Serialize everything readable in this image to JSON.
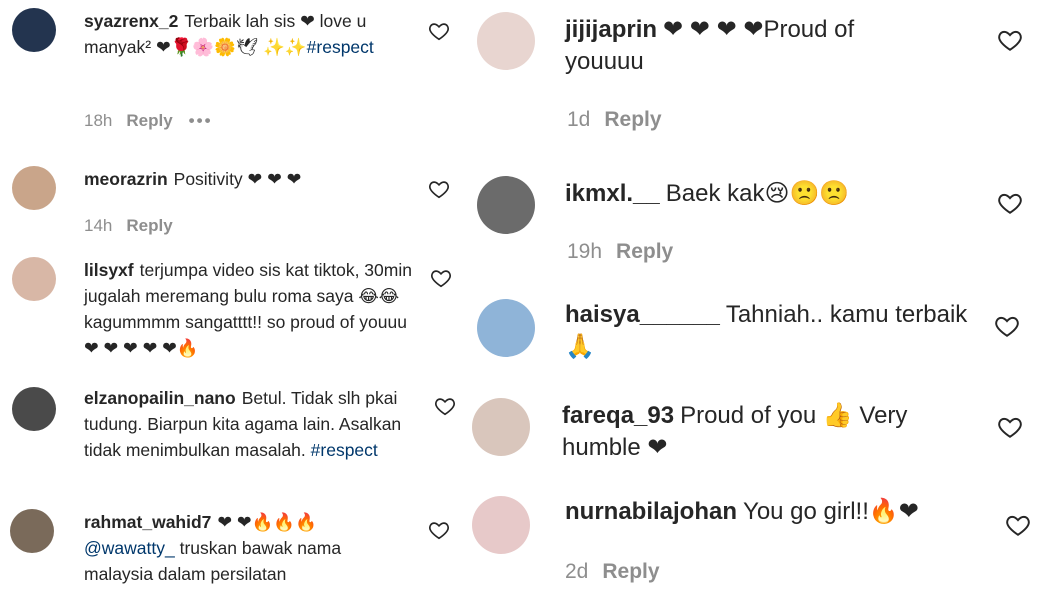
{
  "left": [
    {
      "username": "syazrenx_2",
      "text": "Terbaik lah sis ❤ love u manyak² ❤🌹🌸🌼🕊 ✨✨",
      "hashtag": "#respect",
      "time": "18h",
      "reply": "Reply",
      "more": "•••",
      "avatar_color": "#23344f"
    },
    {
      "username": "meorazrin",
      "text": "Positivity ❤ ❤ ❤",
      "time": "14h",
      "reply": "Reply",
      "avatar_color": "#c9a58a"
    },
    {
      "username": "lilsyxf",
      "text": "terjumpa video sis kat tiktok, 30min jugalah meremang bulu roma saya 😂😂 kagummmm sangatttt!! so proud of youuu❤ ❤ ❤ ❤ ❤🔥",
      "avatar_color": "#d8b7a6"
    },
    {
      "username": "elzanopailin_nano",
      "text": "Betul. Tidak slh pkai tudung. Biarpun kita agama lain. Asalkan tidak menimbulkan masalah.",
      "hashtag": "#respect",
      "avatar_color": "#4a4a4a"
    },
    {
      "username": "rahmat_wahid7",
      "text": "❤ ❤🔥🔥🔥",
      "mention": "@wawatty_",
      "text2": "truskan bawak nama malaysia dalam persilatan",
      "avatar_color": "#7a6a5a"
    }
  ],
  "right": [
    {
      "username": "jijijaprin",
      "text": "❤ ❤ ❤ ❤Proud of youuuu",
      "time": "1d",
      "reply": "Reply",
      "avatar_color": "#e8d5d0"
    },
    {
      "username": "ikmxl.__",
      "text": "Baek kak😢🙁🙁",
      "time": "19h",
      "reply": "Reply",
      "avatar_color": "#6b6b6b"
    },
    {
      "username": "haisya______",
      "text": "Tahniah.. kamu terbaik 🙏",
      "avatar_color": "#8fb4d8"
    },
    {
      "username": "fareqa_93",
      "text": "Proud of you 👍 Very humble ❤",
      "avatar_color": "#d9c6bc"
    },
    {
      "username": "nurnabilajohan",
      "text": "You go girl!!🔥❤",
      "time": "2d",
      "reply": "Reply",
      "avatar_color": "#e7c9c9"
    }
  ]
}
